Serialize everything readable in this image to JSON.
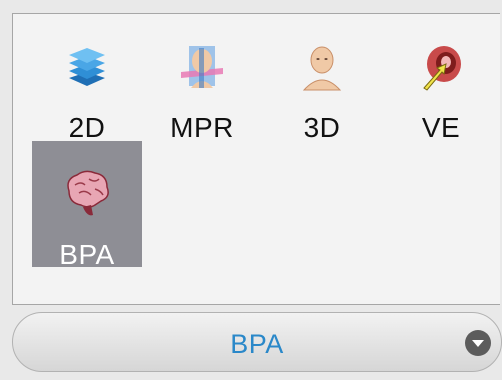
{
  "modes": [
    {
      "label": "2D",
      "icon": "stacked-layers-icon"
    },
    {
      "label": "MPR",
      "icon": "head-planes-icon"
    },
    {
      "label": "3D",
      "icon": "head-bust-icon"
    },
    {
      "label": "VE",
      "icon": "endoscopy-arrow-icon"
    },
    {
      "label": "BPA",
      "icon": "brain-icon",
      "selected": true
    }
  ],
  "selector": {
    "value": "BPA",
    "icon": "chevron-down-icon"
  },
  "colors": {
    "panel_bg": "#f3f3f3",
    "selected_tile": "#8e8e95",
    "selector_text": "#2a88c9",
    "layers_blue": "#2f8fd6",
    "skin": "#f0c9a6",
    "brain_pink": "#e8a6b4"
  }
}
